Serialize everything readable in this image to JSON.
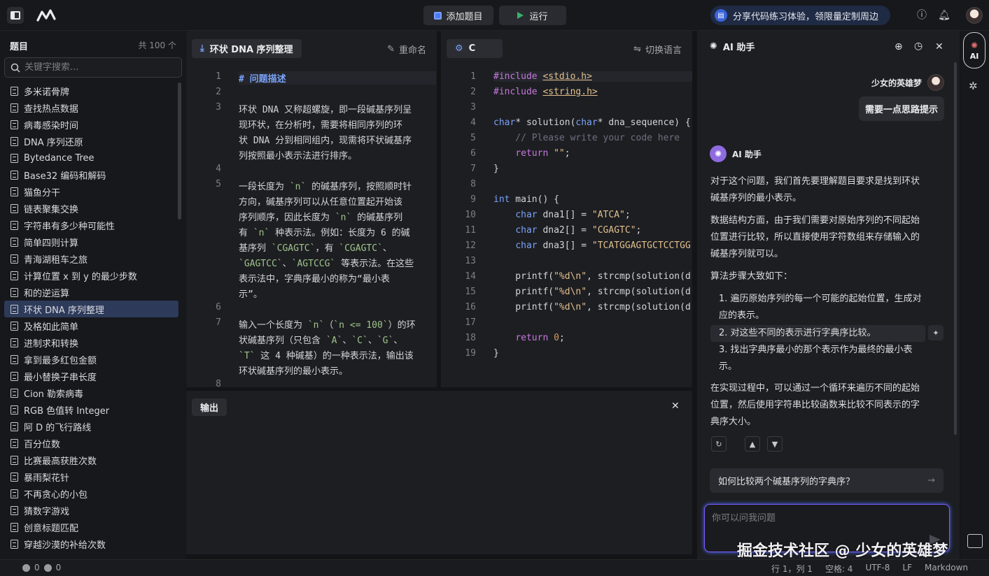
{
  "topbar": {
    "add_problem": "添加题目",
    "run": "运行",
    "promo": "分享代码练习体验，领限量定制周边"
  },
  "left": {
    "title": "题目",
    "count": "共 100 个",
    "search_placeholder": "关键字搜索...",
    "items": [
      "多米诺骨牌",
      "查找热点数据",
      "病毒感染时间",
      "DNA 序列还原",
      "Bytedance Tree",
      "Base32 编码和解码",
      "猫鱼分干",
      "链表聚集交换",
      "字符串有多少种可能性",
      "简单四则计算",
      "青海湖租车之旅",
      "计算位置 x 到 y 的最少步数",
      "和的逆运算",
      "环状 DNA 序列整理",
      "及格如此简单",
      "进制求和转换",
      "拿到最多红包金额",
      "最小替换子串长度",
      "Cion 勒索病毒",
      "RGB 色值转 Integer",
      "阿 D 的飞行路线",
      "百分位数",
      "比赛最高获胜次数",
      "暴雨梨花针",
      "不再贪心的小包",
      "猜数字游戏",
      "创意标题匹配",
      "穿越沙漠的补给次数"
    ],
    "active_index": 13
  },
  "desc": {
    "tab": "环状 DNA 序列整理",
    "rename": "重命名",
    "lines": [
      {
        "n": "1",
        "t": "# 问题描述"
      },
      {
        "n": "2",
        "t": ""
      },
      {
        "n": "3",
        "t": "环状 DNA 又称超螺旋，即一段碱基序列呈"
      },
      {
        "n": "",
        "t": "现环状，在分析时，需要将相同序列的环"
      },
      {
        "n": "",
        "t": "状 DNA 分到相同组内，现需将环状碱基序"
      },
      {
        "n": "",
        "t": "列按照最小表示法进行排序。"
      },
      {
        "n": "4",
        "t": ""
      },
      {
        "n": "5",
        "t": "一段长度为 `n` 的碱基序列，按照顺时针"
      },
      {
        "n": "",
        "t": "方向，碱基序列可以从任意位置起开始该"
      },
      {
        "n": "",
        "t": "序列顺序，因此长度为 `n` 的碱基序列"
      },
      {
        "n": "",
        "t": "有 `n` 种表示法。例如：长度为 6 的碱"
      },
      {
        "n": "",
        "t": "基序列 `CGAGTC`，有 `CGAGTC`、"
      },
      {
        "n": "",
        "t": "`GAGTCC`、`AGTCCG` 等表示法。在这些"
      },
      {
        "n": "",
        "t": "表示法中，字典序最小的称为“最小表"
      },
      {
        "n": "",
        "t": "示”。"
      },
      {
        "n": "6",
        "t": ""
      },
      {
        "n": "7",
        "t": "输入一个长度为 `n`（`n <= 100`）的环"
      },
      {
        "n": "",
        "t": "状碱基序列（只包含 `A`、`C`、`G`、"
      },
      {
        "n": "",
        "t": "`T` 这 4 种碱基）的一种表示法，输出该"
      },
      {
        "n": "",
        "t": "环状碱基序列的最小表示。"
      },
      {
        "n": "8",
        "t": ""
      }
    ]
  },
  "editor": {
    "lang": "C",
    "switch": "切换语言",
    "lines": [
      "#include <stdio.h>",
      "#include <string.h>",
      "",
      "char* solution(char* dna_sequence) {",
      "    // Please write your code here",
      "    return \"\";",
      "}",
      "",
      "int main() {",
      "    char dna1[] = \"ATCA\";",
      "    char dna2[] = \"CGAGTC\";",
      "    char dna3[] = \"TCATGGAGTGCTCCTGG",
      "",
      "    printf(\"%d\\n\", strcmp(solution(d",
      "    printf(\"%d\\n\", strcmp(solution(d",
      "    printf(\"%d\\n\", strcmp(solution(d",
      "",
      "    return 0;",
      "}"
    ]
  },
  "output": {
    "label": "输出"
  },
  "ai": {
    "title": "AI 助手",
    "user_name": "少女的英雄梦",
    "user_msg": "需要一点思路提示",
    "bot_name": "AI 助手",
    "p1": "对于这个问题，我们首先要理解题目要求是找到环状碱基序列的最小表示。",
    "p2": "数据结构方面，由于我们需要对原始序列的不同起始位置进行比较，所以直接使用字符数组来存储输入的碱基序列就可以。",
    "p3": "算法步骤大致如下：",
    "steps": [
      "1. 遍历原始序列的每一个可能的起始位置，生成对应的表示。",
      "2. 对这些不同的表示进行字典序比较。",
      "3. 找出字典序最小的那个表示作为最终的最小表示。"
    ],
    "p4": "在实现过程中，可以通过一个循环来遍历不同的起始位置，然后使用字符串比较函数来比较不同表示的字典序大小。",
    "suggestion": "如何比较两个碱基序列的字典序？",
    "input_placeholder": "你可以问我问题"
  },
  "rail": {
    "ai": "AI"
  },
  "status": {
    "errors": "0",
    "warnings": "0",
    "position": "行 1，列 1",
    "spaces": "空格: 4",
    "encoding": "UTF-8",
    "eol": "LF",
    "mode": "Markdown"
  },
  "watermark": "掘金技术社区 @ 少女的英雄梦"
}
